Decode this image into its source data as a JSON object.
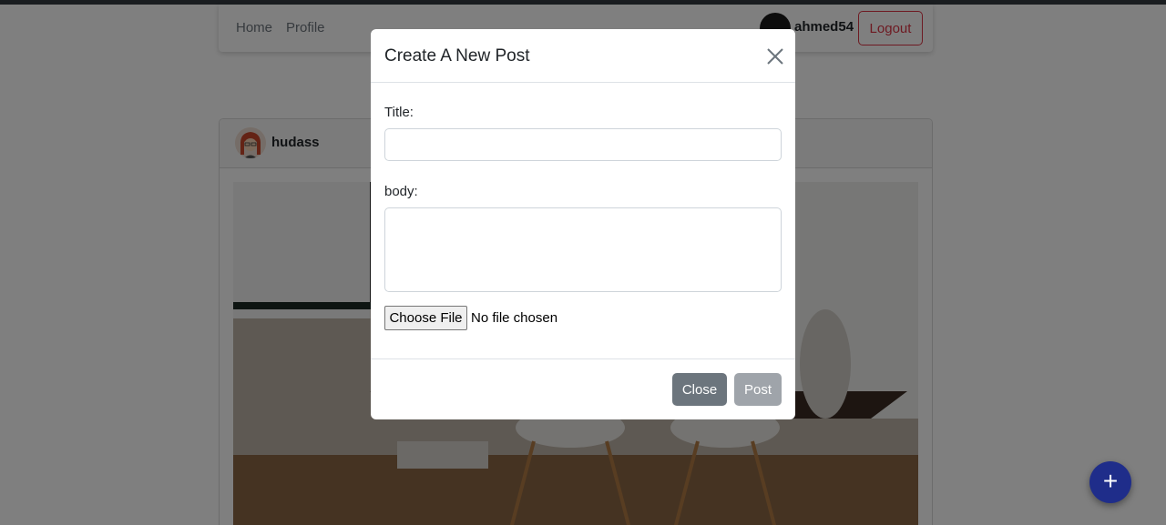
{
  "navbar": {
    "links": [
      "Home",
      "Profile"
    ],
    "username": "ahmed54",
    "logout_label": "Logout"
  },
  "post": {
    "author": "hudass"
  },
  "fab": {
    "label": "+"
  },
  "modal": {
    "title": "Create A New Post",
    "title_label": "Title:",
    "body_label": "body:",
    "title_value": "",
    "body_value": "",
    "file_button_label": "Choose File",
    "file_status": "No file chosen",
    "close_label": "Close",
    "post_label": "Post"
  },
  "colors": {
    "danger": "#dc3545",
    "secondary": "#6c757d",
    "fab": "#1f2d8a",
    "backdrop": "rgba(0,0,0,0.5)"
  },
  "icons": {
    "modal_close": "close-icon",
    "fab": "plus-icon"
  }
}
